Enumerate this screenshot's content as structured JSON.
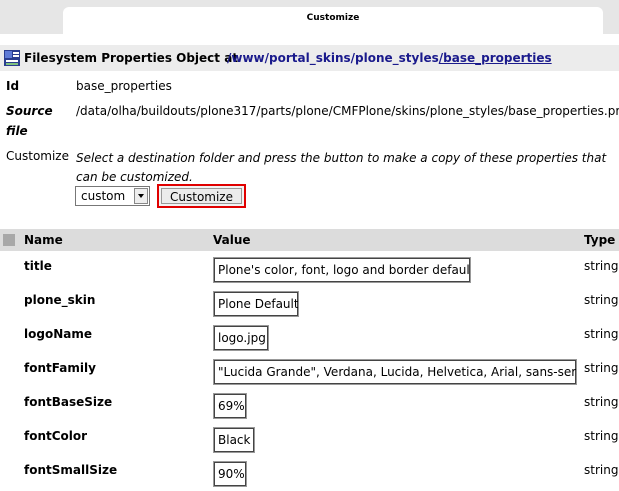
{
  "window": {
    "tab_title": "Customize"
  },
  "object": {
    "title": "Filesystem Properties Object at",
    "path": [
      {
        "text": "/www"
      },
      {
        "text": "/portal_skins"
      },
      {
        "text": "/plone_styles"
      },
      {
        "text": "/base_properties"
      }
    ]
  },
  "info": {
    "id_label": "Id",
    "id_value": "base_properties",
    "source_label": "Source",
    "source_label2": "file",
    "source_value": "/data/olha/buildouts/plone317/parts/plone/CMFPlone/skins/plone_styles/base_properties.props",
    "customize_label": "Customize",
    "customize_desc": "Select a destination folder and press the button to make a copy of these properties that can be customized.",
    "folder_selected": "custom",
    "customize_button": "Customize"
  },
  "table": {
    "headers": {
      "name": "Name",
      "value": "Value",
      "type": "Type"
    },
    "rows": [
      {
        "name": "title",
        "value": "Plone's color, font, logo and border defaults",
        "type": "string"
      },
      {
        "name": "plone_skin",
        "value": "Plone Default",
        "type": "string"
      },
      {
        "name": "logoName",
        "value": "logo.jpg",
        "type": "string"
      },
      {
        "name": "fontFamily",
        "value": "\"Lucida Grande\", Verdana, Lucida, Helvetica, Arial, sans-serif",
        "type": "string"
      },
      {
        "name": "fontBaseSize",
        "value": "69%",
        "type": "string"
      },
      {
        "name": "fontColor",
        "value": "Black",
        "type": "string"
      },
      {
        "name": "fontSmallSize",
        "value": "90%",
        "type": "string"
      }
    ]
  }
}
